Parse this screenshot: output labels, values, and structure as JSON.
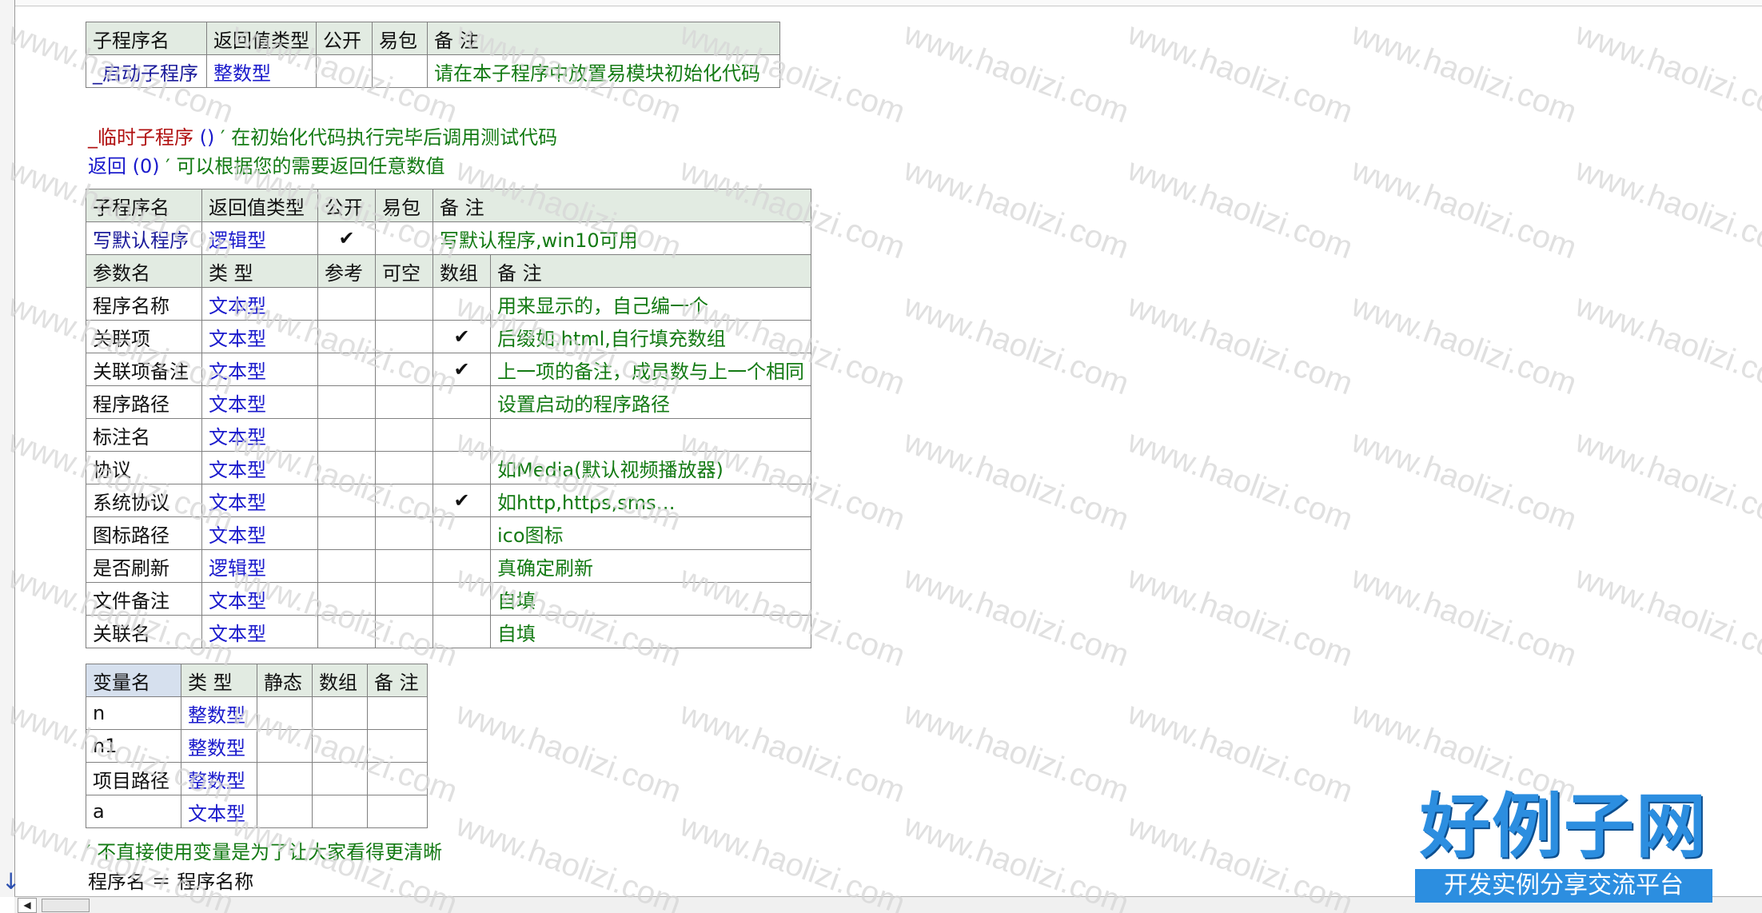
{
  "table1": {
    "headers": [
      "子程序名",
      "返回值类型",
      "公开",
      "易包",
      "备 注"
    ],
    "row": {
      "name": "_启动子程序",
      "type": "整数型",
      "public": "",
      "epkg": "",
      "note": "请在本子程序中放置易模块初始化代码"
    }
  },
  "code1": {
    "call_name": "_临时子程序",
    "call_paren": " ()",
    "call_comment": "  ′ 在初始化代码执行完毕后调用测试代码",
    "ret_kw": "返回",
    "ret_arg": " (0)",
    "ret_comment": "  ′ 可以根据您的需要返回任意数值"
  },
  "table2": {
    "headers": [
      "子程序名",
      "返回值类型",
      "公开",
      "易包",
      "备 注"
    ],
    "sub": {
      "name": "写默认程序",
      "type": "逻辑型",
      "public": "✔",
      "epkg": "",
      "note": "写默认程序,win10可用"
    },
    "param_headers": [
      "参数名",
      "类 型",
      "参考",
      "可空",
      "数组",
      "备 注"
    ],
    "params": [
      {
        "name": "程序名称",
        "type": "文本型",
        "ref": "",
        "nullable": "",
        "array": "",
        "note": "用来显示的，自己编一个"
      },
      {
        "name": "关联项",
        "type": "文本型",
        "ref": "",
        "nullable": "",
        "array": "✔",
        "note": "后缀如.html,自行填充数组"
      },
      {
        "name": "关联项备注",
        "type": "文本型",
        "ref": "",
        "nullable": "",
        "array": "✔",
        "note": "上一项的备注，成员数与上一个相同"
      },
      {
        "name": "程序路径",
        "type": "文本型",
        "ref": "",
        "nullable": "",
        "array": "",
        "note": "设置启动的程序路径"
      },
      {
        "name": "标注名",
        "type": "文本型",
        "ref": "",
        "nullable": "",
        "array": "",
        "note": ""
      },
      {
        "name": "协议",
        "type": "文本型",
        "ref": "",
        "nullable": "",
        "array": "",
        "note": "如Media(默认视频播放器)"
      },
      {
        "name": "系统协议",
        "type": "文本型",
        "ref": "",
        "nullable": "",
        "array": "✔",
        "note": "如http,https,sms…"
      },
      {
        "name": "图标路径",
        "type": "文本型",
        "ref": "",
        "nullable": "",
        "array": "",
        "note": "ico图标"
      },
      {
        "name": "是否刷新",
        "type": "逻辑型",
        "ref": "",
        "nullable": "",
        "array": "",
        "note": "真确定刷新"
      },
      {
        "name": "文件备注",
        "type": "文本型",
        "ref": "",
        "nullable": "",
        "array": "",
        "note": "自填"
      },
      {
        "name": "关联名",
        "type": "文本型",
        "ref": "",
        "nullable": "",
        "array": "",
        "note": "自填"
      }
    ]
  },
  "table3": {
    "headers": [
      "变量名",
      "类 型",
      "静态",
      "数组",
      "备 注"
    ],
    "vars": [
      {
        "name": "n",
        "type": "整数型",
        "static": "",
        "array": "",
        "note": ""
      },
      {
        "name": "n1",
        "type": "整数型",
        "static": "",
        "array": "",
        "note": ""
      },
      {
        "name": "项目路径",
        "type": "整数型",
        "static": "",
        "array": "",
        "note": ""
      },
      {
        "name": "a",
        "type": "文本型",
        "static": "",
        "array": "",
        "note": ""
      }
    ]
  },
  "code2": {
    "comment": "′ 不直接使用变量是为了让大家看得更清晰",
    "assign": "程序名 ＝ 程序名称"
  },
  "watermark_text": "www.haolizi.com",
  "logo": {
    "title": "好例子网",
    "subtitle": "开发实例分享交流平台"
  },
  "colors": {
    "keyword_blue": "#1a1acc",
    "comment_green": "#137a13",
    "header_bg": "#e2ebe2",
    "check_red": "#a0162a",
    "logo_blue": "#2c8ee0"
  }
}
